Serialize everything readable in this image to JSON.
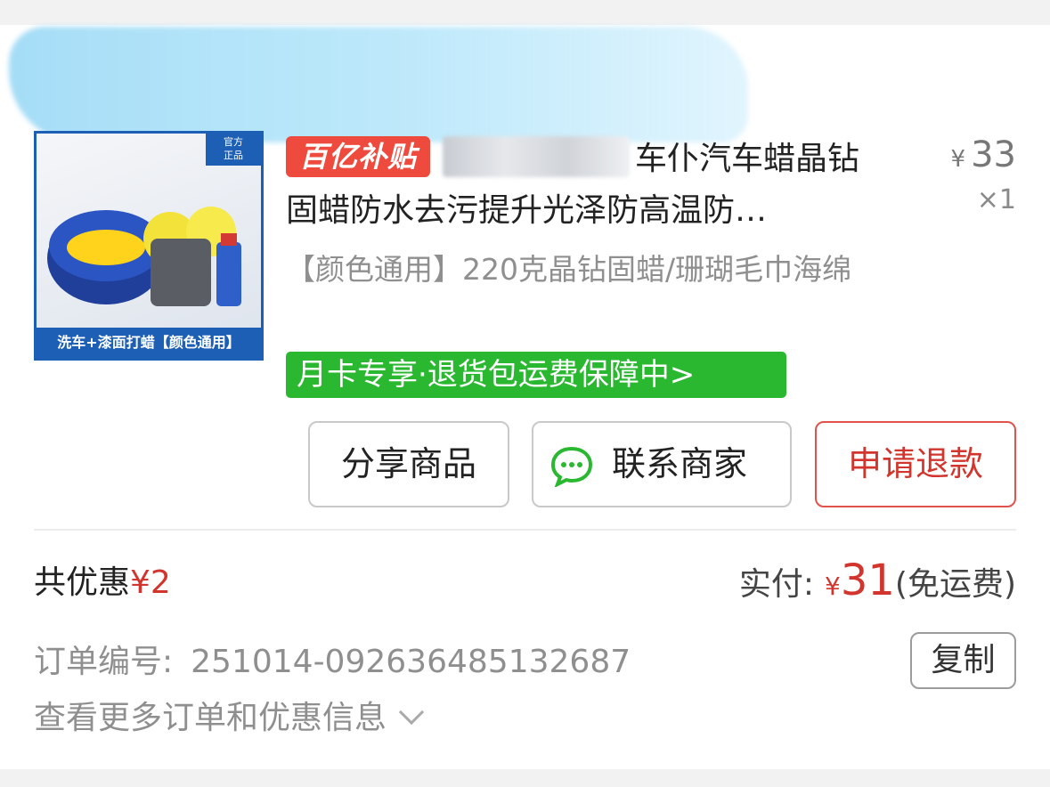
{
  "product": {
    "thumbnail": {
      "badge": "官方\n正品",
      "caption": "洗车+漆面打蜡【颜色通用】"
    },
    "tag": "百亿补贴",
    "title_line1": "车仆汽车蜡晶钻",
    "title_line2": "固蜡防水去污提升光泽防高温防…",
    "price_currency": "¥",
    "price": "33",
    "quantity": "×1",
    "spec": "【颜色通用】220克晶钻固蜡/珊瑚毛巾海绵",
    "service_tag": "月卡专享·退货包运费保障中>"
  },
  "actions": {
    "share": "分享商品",
    "contact": "联系商家",
    "refund": "申请退款"
  },
  "summary": {
    "discount_label": "共优惠",
    "discount_value": "¥2",
    "paid_label": "实付:",
    "paid_currency": "¥",
    "paid_amount": "31",
    "shipping_note": "(免运费)"
  },
  "order": {
    "number_label": "订单编号:",
    "number": "251014-092636485132687",
    "copy": "复制",
    "more": "查看更多订单和优惠信息"
  },
  "colors": {
    "accent_red": "#d2352d",
    "subsidy_red": "#ef4a3e",
    "service_green": "#2ab830",
    "brand_blue": "#1d5fb5"
  },
  "icons": [
    "chat-icon",
    "chevron-down-icon"
  ]
}
